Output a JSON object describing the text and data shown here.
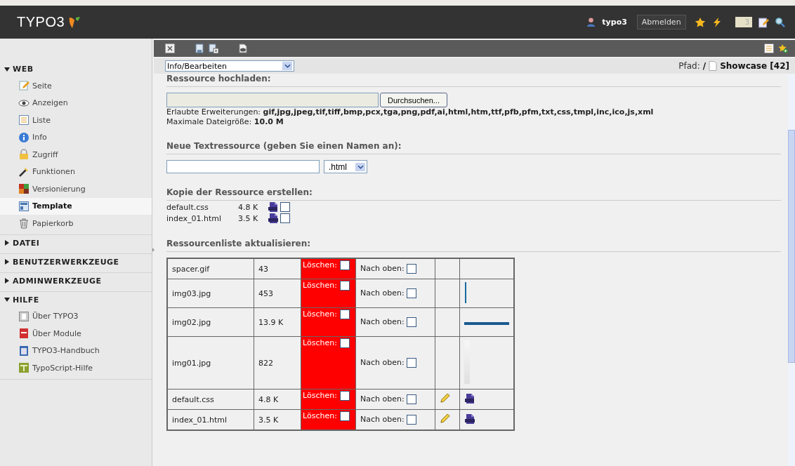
{
  "topbar": {
    "logo": "TYPO3",
    "user": "typo3",
    "logout": "Abmelden",
    "workspace_count": "3"
  },
  "sidebar": {
    "groups": [
      {
        "label": "WEB",
        "expanded": true,
        "items": [
          {
            "label": "Seite",
            "selected": false
          },
          {
            "label": "Anzeigen",
            "selected": false
          },
          {
            "label": "Liste",
            "selected": false
          },
          {
            "label": "Info",
            "selected": false
          },
          {
            "label": "Zugriff",
            "selected": false
          },
          {
            "label": "Funktionen",
            "selected": false
          },
          {
            "label": "Versionierung",
            "selected": false
          },
          {
            "label": "Template",
            "selected": true
          },
          {
            "label": "Papierkorb",
            "selected": false
          }
        ]
      },
      {
        "label": "DATEI",
        "expanded": false
      },
      {
        "label": "BENUTZERWERKZEUGE",
        "expanded": false
      },
      {
        "label": "ADMINWERKZEUGE",
        "expanded": false
      },
      {
        "label": "HILFE",
        "expanded": true,
        "items": [
          {
            "label": "Über TYPO3",
            "selected": false
          },
          {
            "label": "Über Module",
            "selected": false
          },
          {
            "label": "TYPO3-Handbuch",
            "selected": false
          },
          {
            "label": "TypoScript-Hilfe",
            "selected": false
          }
        ]
      }
    ]
  },
  "docheader": {
    "function_menu": "Info/Bearbeiten",
    "path_label": "Pfad:",
    "path_root": "/",
    "path_page": "Showcase [42]"
  },
  "upload": {
    "heading": "Ressource hochladen:",
    "browse_button": "Durchsuchen...",
    "extensions": "Erlaubte Erweiterungen: **gif,jpg,jpeg,tif,tiff,bmp,pcx,tga,png,pdf,ai,html,htm,ttf,pfb,pfm,txt,css,tmpl,inc,ico,js,xml**",
    "max_size": "Maximale Dateigröße: **10.0 M**"
  },
  "new_text": {
    "heading": "Neue Textressource (geben Sie einen Namen an):",
    "extension": ".html"
  },
  "copy": {
    "heading": "Kopie der Ressource erstellen:",
    "files": [
      {
        "name": "default.css",
        "size": "4.8 K",
        "kind": "css",
        "checked": false
      },
      {
        "name": "index_01.html",
        "size": "3.5 K",
        "kind": "html",
        "checked": false
      }
    ]
  },
  "resources": {
    "heading": "Ressourcenliste aktualisieren:",
    "rows": [
      {
        "name": "spacer.gif",
        "size": "43",
        "delete_label": "Löschen:",
        "delete_checked": false,
        "up_label": "Nach oben:",
        "up_checked": false,
        "editable": false,
        "kind": "none"
      },
      {
        "name": "img03.jpg",
        "size": "453",
        "delete_label": "Löschen:",
        "delete_checked": false,
        "up_label": "Nach oben:",
        "up_checked": false,
        "editable": false
      },
      {
        "name": "img02.jpg",
        "size": "13.9 K",
        "delete_label": "Löschen:",
        "delete_checked": false,
        "up_label": "Nach oben:",
        "up_checked": false,
        "editable": false
      },
      {
        "name": "img01.jpg",
        "size": "822",
        "delete_label": "Löschen:",
        "delete_checked": false,
        "up_label": "Nach oben:",
        "up_checked": false,
        "editable": false
      },
      {
        "name": "default.css",
        "size": "4.8 K",
        "delete_label": "Löschen:",
        "delete_checked": false,
        "up_label": "Nach oben:",
        "up_checked": false,
        "editable": true,
        "kind": "css"
      },
      {
        "name": "index_01.html",
        "size": "3.5 K",
        "delete_label": "Löschen:",
        "delete_checked": false,
        "up_label": "Nach oben:",
        "up_checked": false,
        "editable": true,
        "kind": "html"
      }
    ]
  }
}
